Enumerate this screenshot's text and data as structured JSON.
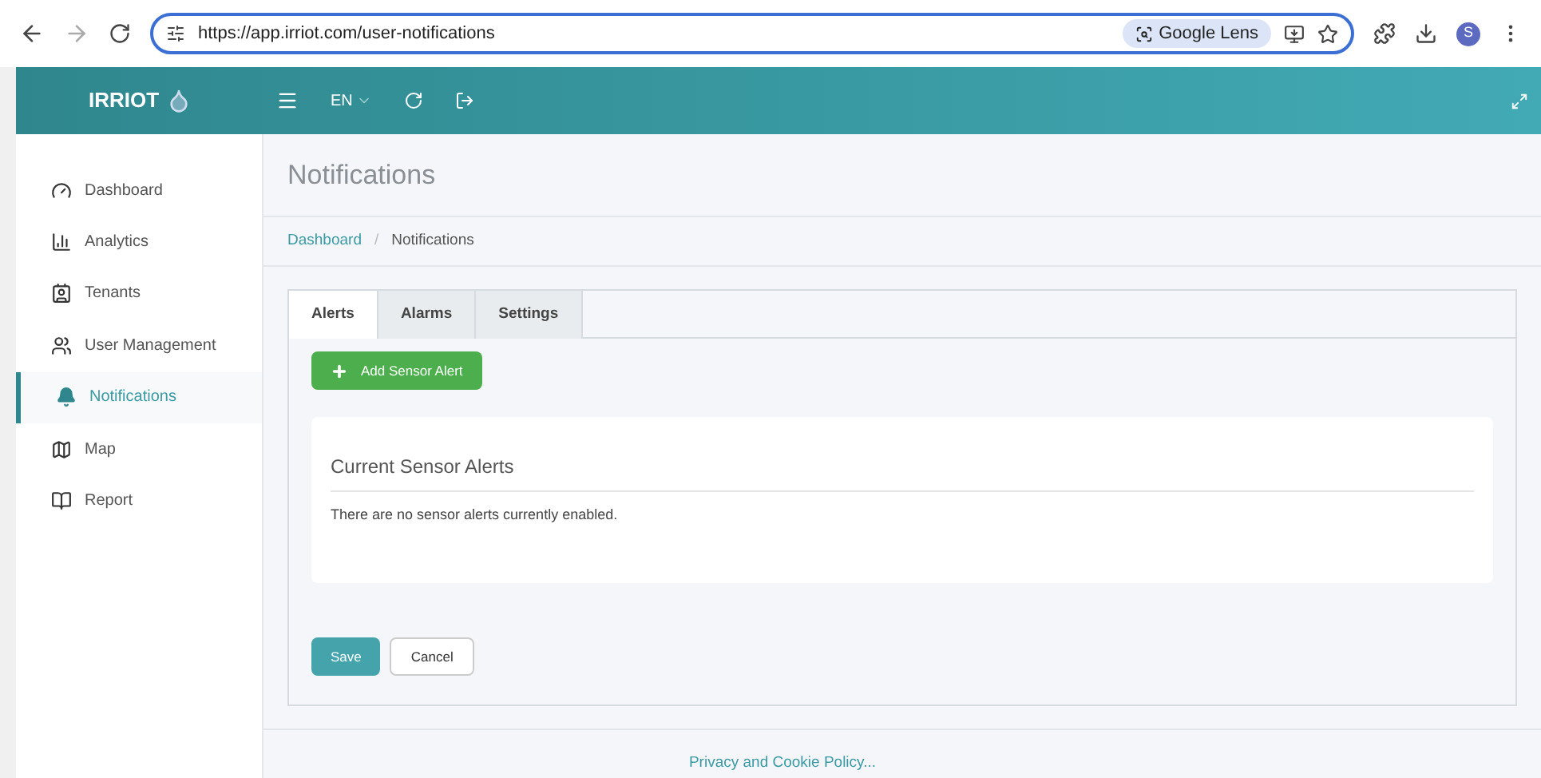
{
  "browser": {
    "url": "https://app.irriot.com/user-notifications",
    "lens_label": "Google Lens",
    "profile_initial": "S"
  },
  "header": {
    "logo": "IRRIOT",
    "language": "EN"
  },
  "sidebar": {
    "items": [
      {
        "label": "Dashboard",
        "selected": false
      },
      {
        "label": "Analytics",
        "selected": false
      },
      {
        "label": "Tenants",
        "selected": false
      },
      {
        "label": "User Management",
        "selected": false
      },
      {
        "label": "Notifications",
        "selected": true
      },
      {
        "label": "Map",
        "selected": false
      },
      {
        "label": "Report",
        "selected": false
      }
    ]
  },
  "page": {
    "title": "Notifications",
    "breadcrumb": [
      {
        "label": "Dashboard",
        "kind": "link"
      },
      {
        "label": "/",
        "kind": "separator"
      },
      {
        "label": "Notifications",
        "kind": "current"
      }
    ]
  },
  "tabs": [
    {
      "label": "Alerts",
      "selected": true
    },
    {
      "label": "Alarms",
      "selected": false
    },
    {
      "label": "Settings",
      "selected": false
    }
  ],
  "add_button": "Add Sensor Alert",
  "card": {
    "title": "Current Sensor Alerts",
    "message": "There are no sensor alerts currently enabled."
  },
  "buttons": [
    {
      "label": "Save",
      "kind": "primary"
    },
    {
      "label": "Cancel",
      "kind": "default"
    }
  ],
  "footer": {
    "link": "Privacy and Cookie Policy..."
  }
}
